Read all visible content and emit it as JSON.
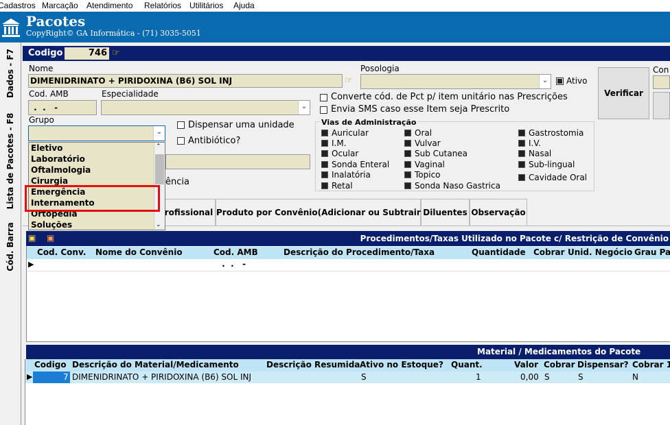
{
  "menu": [
    "Cadastros",
    "Marcação",
    "Atendimento",
    "Relatórios",
    "Utilitários",
    "Ajuda"
  ],
  "header": {
    "title": "Pacotes",
    "subtitle": "CopyRight© GA Informática - (71) 3035-5051"
  },
  "side_tabs": [
    "Dados - F7",
    "Lista de Pacotes - F8",
    "Cód. Barra"
  ],
  "codigo": {
    "label": "Codigo",
    "value": "746"
  },
  "nome": {
    "label": "Nome",
    "value": "DIMENIDRINATO + PIRIDOXINA (B6) SOL INJ"
  },
  "posologia": {
    "label": "Posologia",
    "value": ""
  },
  "ativo": {
    "label": "Ativo",
    "checked": true
  },
  "verificar_label": "Verificar",
  "con_label": "Con",
  "cod_amb": {
    "label": "Cod. AMB",
    "value": " .  .   -"
  },
  "especialidade": {
    "label": "Especialidade",
    "value": ""
  },
  "converte_label": "Converte cód. de Pct p/ item unitário nas Prescrições",
  "envia_sms_label": "Envia SMS caso esse Item seja Prescrito",
  "grupo": {
    "label": "Grupo",
    "value": ""
  },
  "dispensar_label": "Dispensar uma unidade",
  "antibiotico_label": "Antibiótico?",
  "partial_label": "ência",
  "grupo_options": [
    "Eletivo",
    "Laboratório",
    "Oftalmologia",
    "Cirurgia",
    "Emergência",
    "Internamento",
    "Ortopedia",
    "Soluções"
  ],
  "vias": {
    "title": "Vias de Administração",
    "col1": [
      "Auricular",
      "I.M.",
      "Ocular",
      "Sonda Enteral",
      "Inalatória",
      "Retal"
    ],
    "col2": [
      "Oral",
      "Vulvar",
      "Sub Cutanea",
      "Vaginal",
      "Topico",
      "Sonda Naso Gastrica"
    ],
    "col3": [
      "Gastrostomia",
      "I.V.",
      "Nasal",
      "Sub-lingual",
      "Cavidade Oral"
    ]
  },
  "tabs": [
    "rofissional",
    "Produto por Convênio(Adicionar  ou Subtrair)",
    "Diluentes",
    "Observação"
  ],
  "proc_grid": {
    "title": "Procedimentos/Taxas Utilizado no Pacote c/ Restrição de Convênio",
    "columns": [
      "Cod. Conv.",
      "Nome do Convênio",
      "Cod. AMB",
      "Descrição do Procedimento/Taxa",
      "Quantidade",
      "Cobrar",
      "Unid. Negócio",
      "Grau Pa"
    ],
    "row_cod_amb": " .  .   -"
  },
  "mat_grid": {
    "title": "Material / Medicamentos do Pacote",
    "columns": [
      "Codigo",
      "Descrição do Material/Medicamento",
      "Descrição Resumida",
      "Ativo no Estoque?",
      "Quant.",
      "Valor",
      "Cobrar",
      "Dispensar?",
      "Cobrar 1"
    ],
    "row": {
      "codigo": "7",
      "descricao": "DIMENIDRINATO + PIRIDOXINA (B6) SOL INJ",
      "resumida": "",
      "ativo": "S",
      "quant": "1",
      "valor": "0,00",
      "cobrar": "S",
      "dispensar": "S",
      "cobrar1": "N"
    }
  }
}
